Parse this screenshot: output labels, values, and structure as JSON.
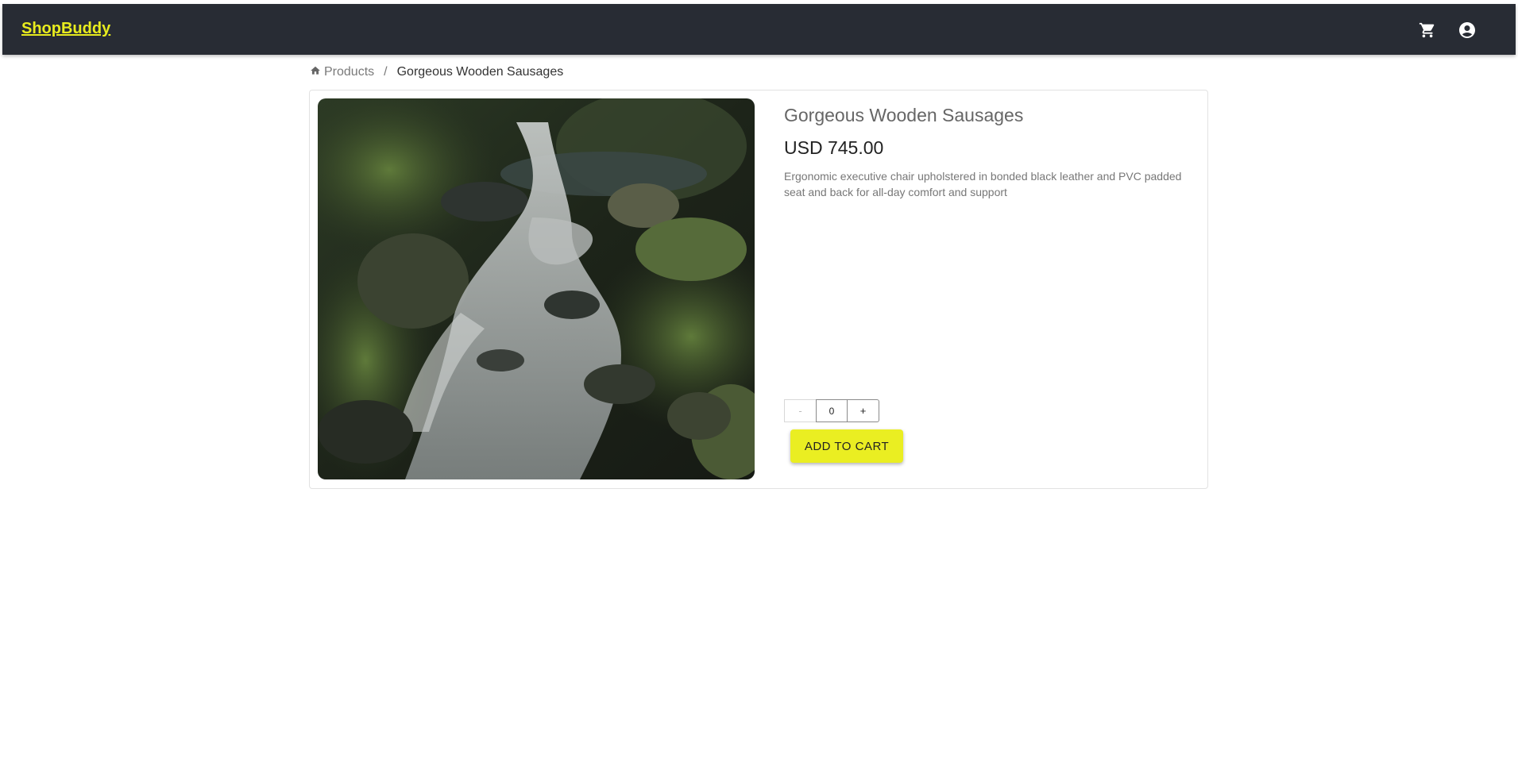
{
  "app": {
    "brand": "ShopBuddy",
    "brand_color": "#e8ec1e",
    "bar_color": "#282c34",
    "icons": [
      "cart-icon",
      "account-circle-icon"
    ]
  },
  "breadcrumb": {
    "home_icon": "home-icon",
    "root": "Products",
    "separator": "/",
    "current": "Gorgeous Wooden Sausages"
  },
  "product": {
    "title": "Gorgeous Wooden Sausages",
    "price": "USD 745.00",
    "description": "Ergonomic executive chair upholstered in bonded black leather and PVC padded seat and back for all-day comfort and support",
    "image": "waterfall-photo"
  },
  "cart_controls": {
    "minus": "-",
    "quantity": "0",
    "plus": "+",
    "add_label": "ADD TO CART",
    "accent": "#eaee22"
  }
}
